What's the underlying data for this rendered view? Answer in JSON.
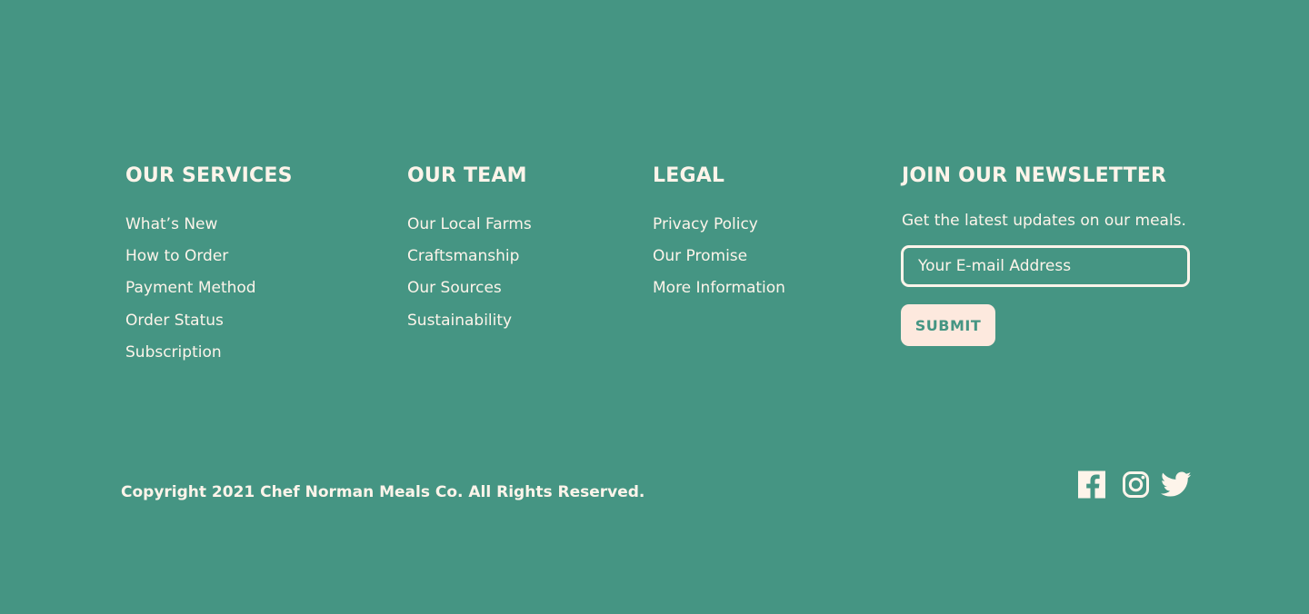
{
  "colors": {
    "background": "#459583",
    "text": "#fdf4ea",
    "button_bg": "#fde9de",
    "button_text": "#459583"
  },
  "services": {
    "heading": "OUR SERVICES",
    "links": [
      "What’s New",
      "How to Order",
      "Payment Method",
      "Order Status",
      "Subscription"
    ]
  },
  "team": {
    "heading": "OUR TEAM",
    "links": [
      "Our Local Farms",
      "Craftsmanship",
      "Our Sources",
      "Sustainability"
    ]
  },
  "legal": {
    "heading": "LEGAL",
    "links": [
      "Privacy Policy",
      "Our Promise",
      "More Information"
    ]
  },
  "newsletter": {
    "heading": "JOIN OUR NEWSLETTER",
    "description": "Get the latest updates on our meals.",
    "email_placeholder": "Your E-mail Address",
    "email_value": "",
    "submit_label": "SUBMIT"
  },
  "copyright": "Copyright 2021 Chef Norman Meals Co. All Rights Reserved.",
  "social": [
    "facebook-icon",
    "instagram-icon",
    "twitter-icon"
  ]
}
